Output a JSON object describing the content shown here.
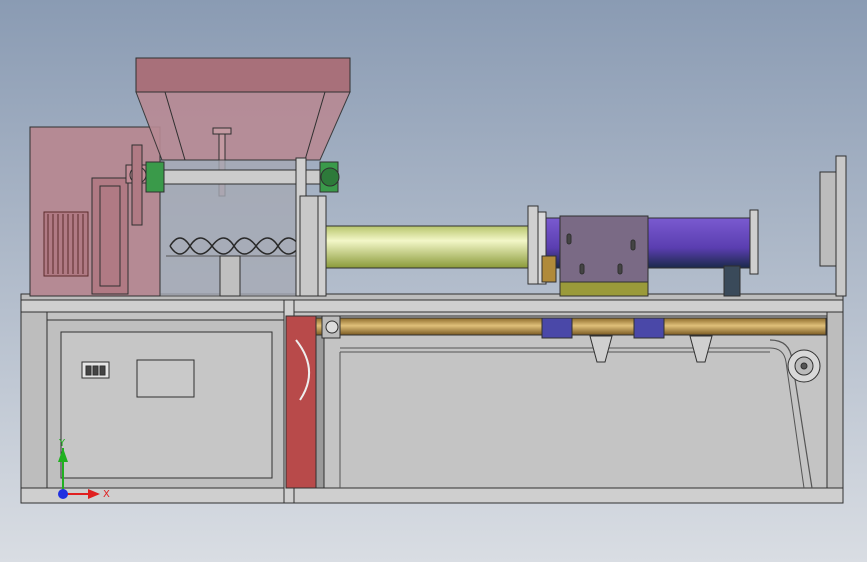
{
  "viewport": {
    "background_top": "#8a9bb3",
    "background_bottom": "#d6dbe2"
  },
  "triad": {
    "x_label": "X",
    "y_label": "Y",
    "x_color": "#e02020",
    "y_color": "#20b020",
    "z_color": "#2030e0"
  },
  "colors": {
    "hopper": "#a8707a",
    "motor_housing": "#b58a94",
    "barrel": "#d9e69a",
    "screw_bearing": "#3a9a4a",
    "blue_tube": "#5a4aa8",
    "heater_block": "#7a6a85",
    "copper_rod": "#b8904a",
    "clamp_blue": "#4a48a8",
    "red_panel": "#b84a4a",
    "frame": "#c8c8c8",
    "edge": "#303030"
  }
}
